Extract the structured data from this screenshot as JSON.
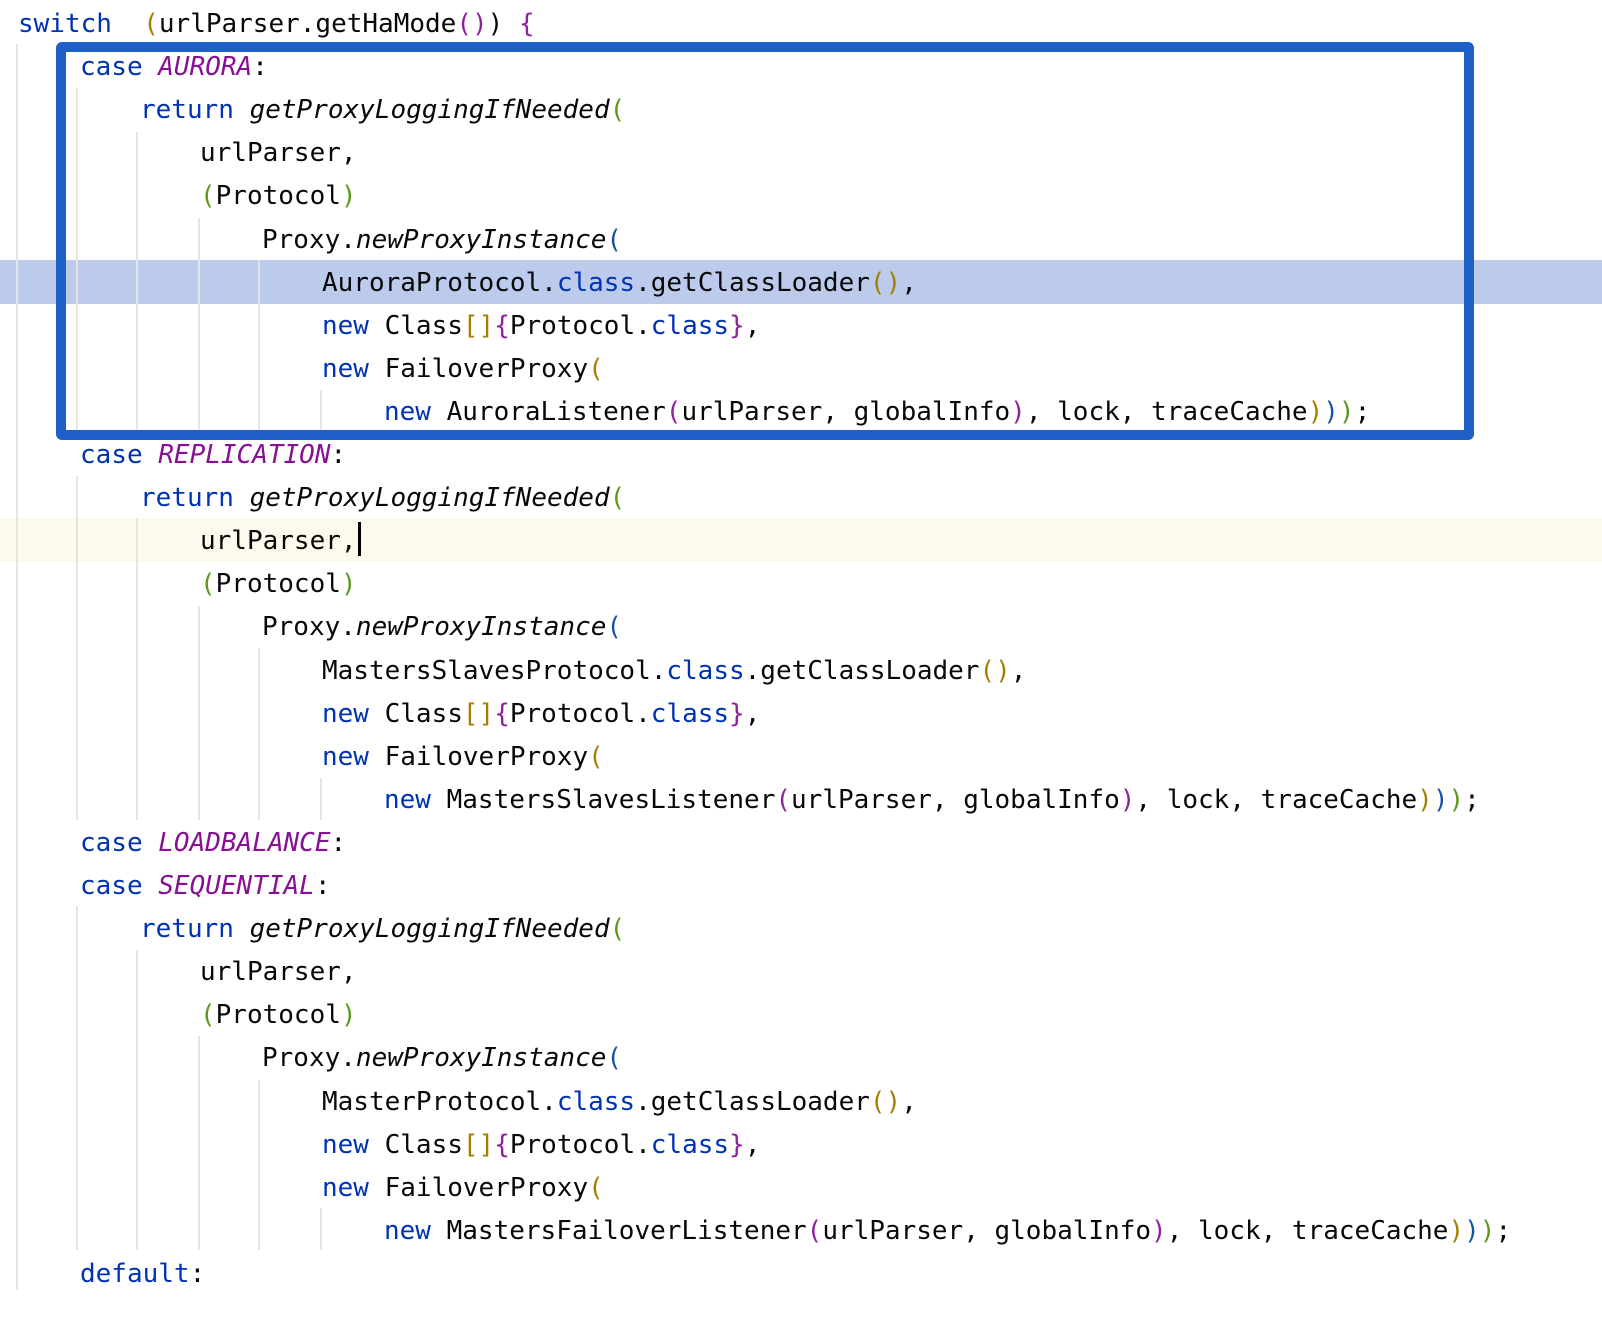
{
  "editor": {
    "lines": [
      {
        "name": "line-switch",
        "tokens": [
          [
            "kw",
            "switch"
          ],
          [
            "",
            "  "
          ],
          [
            "p1",
            "("
          ],
          [
            "",
            "urlParser.getHaMode"
          ],
          [
            "p2",
            "()"
          ],
          [
            "",
            ") "
          ],
          [
            "p2",
            "{"
          ]
        ]
      },
      {
        "name": "line-case-aurora",
        "tokens": [
          [
            "kw",
            "case "
          ],
          [
            "en",
            "AURORA"
          ],
          [
            "",
            ":"
          ]
        ]
      },
      {
        "name": "line-return",
        "tokens": [
          [
            "kw",
            "return "
          ],
          [
            "fn",
            "getProxyLoggingIfNeeded"
          ],
          [
            "p3",
            "("
          ]
        ]
      },
      {
        "name": "line-urlparser",
        "tokens": [
          [
            "",
            "urlParser,"
          ]
        ]
      },
      {
        "name": "line-protocol-cast",
        "tokens": [
          [
            "p3",
            "("
          ],
          [
            "",
            "Protocol"
          ],
          [
            "p3",
            ")"
          ]
        ]
      },
      {
        "name": "line-newproxyinstance",
        "tokens": [
          [
            "",
            "Proxy."
          ],
          [
            "fn",
            "newProxyInstance"
          ],
          [
            "p4",
            "("
          ]
        ]
      },
      {
        "name": "line-classloader",
        "tokens": [
          [
            "",
            "AuroraProtocol."
          ],
          [
            "kw",
            "class"
          ],
          [
            "",
            ".getClassLoader"
          ],
          [
            "p1",
            "()"
          ],
          [
            "",
            ","
          ]
        ]
      },
      {
        "name": "line-class-array",
        "tokens": [
          [
            "kw",
            "new "
          ],
          [
            "",
            "Class"
          ],
          [
            "p1",
            "[]"
          ],
          [
            "p2",
            "{"
          ],
          [
            "",
            "Protocol."
          ],
          [
            "kw",
            "class"
          ],
          [
            "p2",
            "}"
          ],
          [
            "",
            ","
          ]
        ]
      },
      {
        "name": "line-failoverproxy",
        "tokens": [
          [
            "kw",
            "new "
          ],
          [
            "",
            "FailoverProxy"
          ],
          [
            "p1",
            "("
          ]
        ]
      },
      {
        "name": "line-listener",
        "tokens": [
          [
            "kw",
            "new "
          ],
          [
            "",
            "AuroraListener"
          ],
          [
            "p2",
            "("
          ],
          [
            "",
            "urlParser, globalInfo"
          ],
          [
            "p2",
            ")"
          ],
          [
            "",
            ", lock, traceCache"
          ],
          [
            "p1",
            ")"
          ],
          [
            "p4",
            ")"
          ],
          [
            "p3",
            ")"
          ],
          [
            "",
            ";"
          ]
        ]
      },
      {
        "name": "line-case-replication",
        "tokens": [
          [
            "kw",
            "case "
          ],
          [
            "en",
            "REPLICATION"
          ],
          [
            "",
            ":"
          ]
        ]
      },
      {
        "name": "line-return",
        "tokens": [
          [
            "kw",
            "return "
          ],
          [
            "fn",
            "getProxyLoggingIfNeeded"
          ],
          [
            "p3",
            "("
          ]
        ]
      },
      {
        "name": "line-urlparser",
        "tokens": [
          [
            "",
            "urlParser,"
          ]
        ]
      },
      {
        "name": "line-protocol-cast",
        "tokens": [
          [
            "p3",
            "("
          ],
          [
            "",
            "Protocol"
          ],
          [
            "p3",
            ")"
          ]
        ]
      },
      {
        "name": "line-newproxyinstance",
        "tokens": [
          [
            "",
            "Proxy."
          ],
          [
            "fn",
            "newProxyInstance"
          ],
          [
            "p4",
            "("
          ]
        ]
      },
      {
        "name": "line-classloader",
        "tokens": [
          [
            "",
            "MastersSlavesProtocol."
          ],
          [
            "kw",
            "class"
          ],
          [
            "",
            ".getClassLoader"
          ],
          [
            "p1",
            "()"
          ],
          [
            "",
            ","
          ]
        ]
      },
      {
        "name": "line-class-array",
        "tokens": [
          [
            "kw",
            "new "
          ],
          [
            "",
            "Class"
          ],
          [
            "p1",
            "[]"
          ],
          [
            "p2",
            "{"
          ],
          [
            "",
            "Protocol."
          ],
          [
            "kw",
            "class"
          ],
          [
            "p2",
            "}"
          ],
          [
            "",
            ","
          ]
        ]
      },
      {
        "name": "line-failoverproxy",
        "tokens": [
          [
            "kw",
            "new "
          ],
          [
            "",
            "FailoverProxy"
          ],
          [
            "p1",
            "("
          ]
        ]
      },
      {
        "name": "line-listener",
        "tokens": [
          [
            "kw",
            "new "
          ],
          [
            "",
            "MastersSlavesListener"
          ],
          [
            "p2",
            "("
          ],
          [
            "",
            "urlParser, globalInfo"
          ],
          [
            "p2",
            ")"
          ],
          [
            "",
            ", lock, traceCache"
          ],
          [
            "p1",
            ")"
          ],
          [
            "p4",
            ")"
          ],
          [
            "p3",
            ")"
          ],
          [
            "",
            ";"
          ]
        ]
      },
      {
        "name": "line-case-loadbalance",
        "tokens": [
          [
            "kw",
            "case "
          ],
          [
            "en",
            "LOADBALANCE"
          ],
          [
            "",
            ":"
          ]
        ]
      },
      {
        "name": "line-case-sequential",
        "tokens": [
          [
            "kw",
            "case "
          ],
          [
            "en",
            "SEQUENTIAL"
          ],
          [
            "",
            ":"
          ]
        ]
      },
      {
        "name": "line-return",
        "tokens": [
          [
            "kw",
            "return "
          ],
          [
            "fn",
            "getProxyLoggingIfNeeded"
          ],
          [
            "p3",
            "("
          ]
        ]
      },
      {
        "name": "line-urlparser",
        "tokens": [
          [
            "",
            "urlParser,"
          ]
        ]
      },
      {
        "name": "line-protocol-cast",
        "tokens": [
          [
            "p3",
            "("
          ],
          [
            "",
            "Protocol"
          ],
          [
            "p3",
            ")"
          ]
        ]
      },
      {
        "name": "line-newproxyinstance",
        "tokens": [
          [
            "",
            "Proxy."
          ],
          [
            "fn",
            "newProxyInstance"
          ],
          [
            "p4",
            "("
          ]
        ]
      },
      {
        "name": "line-classloader",
        "tokens": [
          [
            "",
            "MasterProtocol."
          ],
          [
            "kw",
            "class"
          ],
          [
            "",
            ".getClassLoader"
          ],
          [
            "p1",
            "()"
          ],
          [
            "",
            ","
          ]
        ]
      },
      {
        "name": "line-class-array",
        "tokens": [
          [
            "kw",
            "new "
          ],
          [
            "",
            "Class"
          ],
          [
            "p1",
            "[]"
          ],
          [
            "p2",
            "{"
          ],
          [
            "",
            "Protocol."
          ],
          [
            "kw",
            "class"
          ],
          [
            "p2",
            "}"
          ],
          [
            "",
            ","
          ]
        ]
      },
      {
        "name": "line-failoverproxy",
        "tokens": [
          [
            "kw",
            "new "
          ],
          [
            "",
            "FailoverProxy"
          ],
          [
            "p1",
            "("
          ]
        ]
      },
      {
        "name": "line-listener",
        "tokens": [
          [
            "kw",
            "new "
          ],
          [
            "",
            "MastersFailoverListener"
          ],
          [
            "p2",
            "("
          ],
          [
            "",
            "urlParser, globalInfo"
          ],
          [
            "p2",
            ")"
          ],
          [
            "",
            ", lock, traceCache"
          ],
          [
            "p1",
            ")"
          ],
          [
            "p4",
            ")"
          ],
          [
            "p3",
            ")"
          ],
          [
            "",
            ";"
          ]
        ]
      },
      {
        "name": "line-default",
        "tokens": [
          [
            "kw",
            "default"
          ],
          [
            "",
            ":"
          ]
        ]
      }
    ]
  }
}
